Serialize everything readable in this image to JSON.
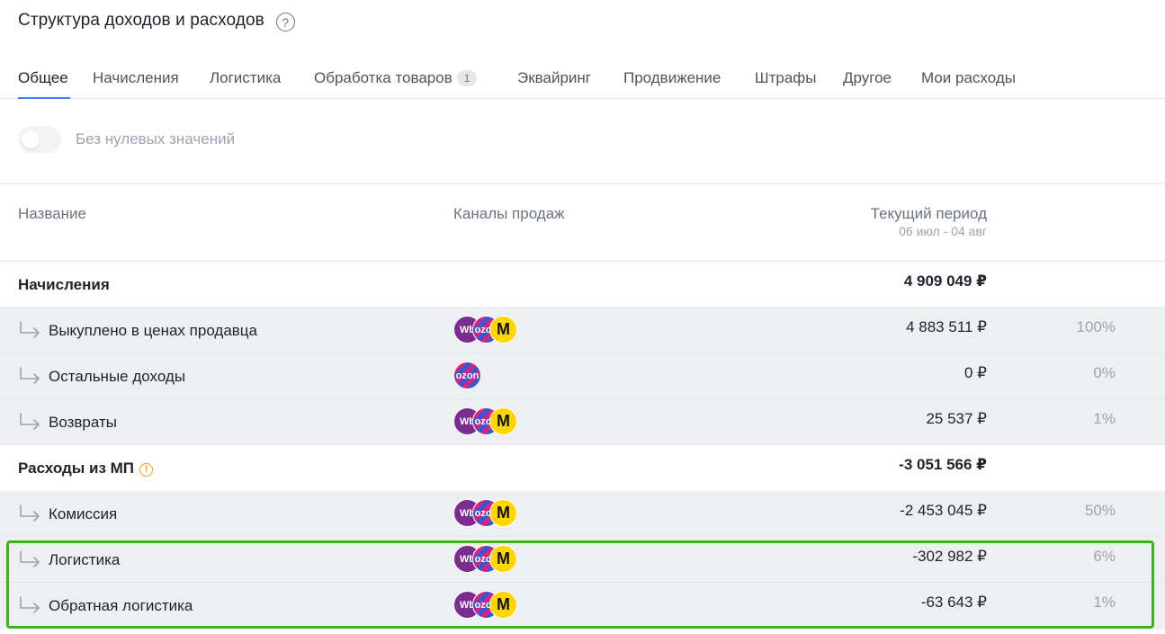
{
  "header": {
    "title": "Структура доходов и расходов",
    "help_icon": "?"
  },
  "tabs": [
    {
      "label": "Общее",
      "active": true
    },
    {
      "label": "Начисления"
    },
    {
      "label": "Логистика"
    },
    {
      "label": "Обработка товаров",
      "badge": "1"
    },
    {
      "label": "Эквайринг"
    },
    {
      "label": "Продвижение"
    },
    {
      "label": "Штрафы"
    },
    {
      "label": "Другое"
    },
    {
      "label": "Мои расходы"
    }
  ],
  "filter": {
    "toggle_label": "Без нулевых значений",
    "enabled": false
  },
  "table": {
    "columns": {
      "name": "Название",
      "channels": "Каналы продаж",
      "period": "Текущий период",
      "period_range": "06 июл - 04 авг"
    },
    "rows": [
      {
        "type": "group",
        "name": "Начисления",
        "value": "4 909 049 ₽"
      },
      {
        "type": "sub",
        "name": "Выкуплено в ценах продавца",
        "channels": [
          "wb",
          "ozon",
          "ym"
        ],
        "value": "4 883 511 ₽",
        "pct": "100%"
      },
      {
        "type": "sub",
        "name": "Остальные доходы",
        "channels": [
          "ozon"
        ],
        "value": "0 ₽",
        "pct": "0%"
      },
      {
        "type": "sub",
        "name": "Возвраты",
        "channels": [
          "wb",
          "ozon",
          "ym"
        ],
        "value": "25 537 ₽",
        "pct": "1%"
      },
      {
        "type": "group",
        "name": "Расходы из МП",
        "warning": true,
        "value": "-3 051 566 ₽"
      },
      {
        "type": "sub",
        "name": "Комиссия",
        "channels": [
          "wb",
          "ozon",
          "ym"
        ],
        "value": "-2 453 045 ₽",
        "pct": "50%"
      },
      {
        "type": "sub",
        "name": "Логистика",
        "channels": [
          "wb",
          "ozon",
          "ym"
        ],
        "value": "-302 982 ₽",
        "pct": "6%"
      },
      {
        "type": "sub",
        "name": "Обратная логистика",
        "channels": [
          "wb",
          "ozon",
          "ym"
        ],
        "value": "-63 643 ₽",
        "pct": "1%"
      }
    ]
  },
  "marketplace_logos": {
    "wb": "Wb",
    "ozon": "ozon",
    "ym": "M"
  },
  "colors": {
    "accent": "#3b82f6",
    "highlight": "#3db31a",
    "warning": "#f59e0b",
    "subrow_bg": "#edeff2"
  },
  "icons": {
    "help": "question-circle-icon",
    "warning": "exclamation-circle-icon",
    "arrow": "sub-arrow-icon"
  }
}
